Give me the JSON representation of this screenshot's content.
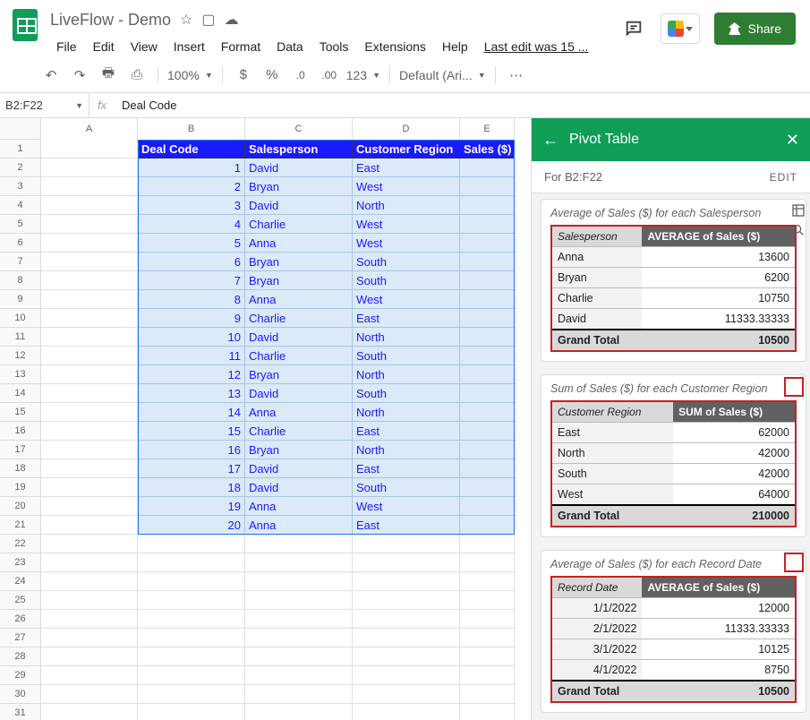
{
  "doc": {
    "title": "LiveFlow - Demo"
  },
  "menus": {
    "file": "File",
    "edit": "Edit",
    "view": "View",
    "insert": "Insert",
    "format": "Format",
    "data": "Data",
    "tools": "Tools",
    "extensions": "Extensions",
    "help": "Help",
    "lastedit": "Last edit was 15 ..."
  },
  "share": {
    "label": "Share"
  },
  "toolbar": {
    "zoom": "100%",
    "currency": "$",
    "percent": "%",
    "decrease": ".0",
    "increase": ".00",
    "numfmt": "123",
    "font": "Default (Ari..."
  },
  "namebox": {
    "ref": "B2:F22",
    "fx": "fx",
    "formula": "Deal Code"
  },
  "columns": [
    "A",
    "B",
    "C",
    "D",
    "E"
  ],
  "table": {
    "headers": [
      "Deal Code",
      "Salesperson",
      "Customer Region",
      "Sales ($)"
    ],
    "rows": [
      [
        "1",
        "David",
        "East"
      ],
      [
        "2",
        "Bryan",
        "West"
      ],
      [
        "3",
        "David",
        "North"
      ],
      [
        "4",
        "Charlie",
        "West"
      ],
      [
        "5",
        "Anna",
        "West"
      ],
      [
        "6",
        "Bryan",
        "South"
      ],
      [
        "7",
        "Bryan",
        "South"
      ],
      [
        "8",
        "Anna",
        "West"
      ],
      [
        "9",
        "Charlie",
        "East"
      ],
      [
        "10",
        "David",
        "North"
      ],
      [
        "11",
        "Charlie",
        "South"
      ],
      [
        "12",
        "Bryan",
        "North"
      ],
      [
        "13",
        "David",
        "South"
      ],
      [
        "14",
        "Anna",
        "North"
      ],
      [
        "15",
        "Charlie",
        "East"
      ],
      [
        "16",
        "Bryan",
        "North"
      ],
      [
        "17",
        "David",
        "East"
      ],
      [
        "18",
        "David",
        "South"
      ],
      [
        "19",
        "Anna",
        "West"
      ],
      [
        "20",
        "Anna",
        "East"
      ]
    ]
  },
  "pivot": {
    "title": "Pivot Table",
    "for": "For B2:F22",
    "edit": "EDIT",
    "suggestions": [
      {
        "title": "Average of Sales ($) for each Salesperson",
        "col1": "Salesperson",
        "col2": "AVERAGE of Sales ($)",
        "rows": [
          [
            "Anna",
            "13600"
          ],
          [
            "Bryan",
            "6200"
          ],
          [
            "Charlie",
            "10750"
          ],
          [
            "David",
            "11333.33333"
          ]
        ],
        "total": [
          "Grand Total",
          "10500"
        ],
        "icons": true
      },
      {
        "title": "Sum of Sales ($) for each Customer Region",
        "col1": "Customer Region",
        "col2": "SUM of Sales ($)",
        "rows": [
          [
            "East",
            "62000"
          ],
          [
            "North",
            "42000"
          ],
          [
            "South",
            "42000"
          ],
          [
            "West",
            "64000"
          ]
        ],
        "total": [
          "Grand Total",
          "210000"
        ]
      },
      {
        "title": "Average of Sales ($) for each Record Date",
        "col1": "Record Date",
        "col2": "AVERAGE of Sales ($)",
        "rows": [
          [
            "1/1/2022",
            "12000"
          ],
          [
            "2/1/2022",
            "11333.33333"
          ],
          [
            "3/1/2022",
            "10125"
          ],
          [
            "4/1/2022",
            "8750"
          ]
        ],
        "total": [
          "Grand Total",
          "10500"
        ],
        "rightAlignKey": true
      }
    ]
  }
}
